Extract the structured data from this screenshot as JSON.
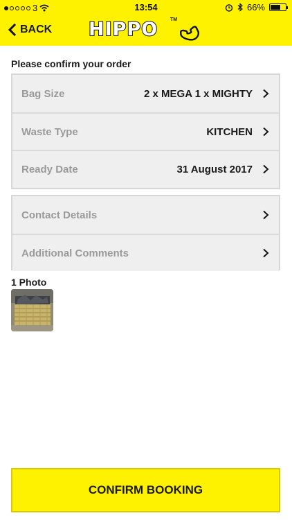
{
  "status_bar": {
    "carrier": "3",
    "time": "13:54",
    "battery_percent": "66%",
    "battery_level": 0.66
  },
  "header": {
    "back_label": "BACK",
    "logo_text": "HIPPO",
    "logo_tm": "TM",
    "brand_color": "#fff200"
  },
  "order": {
    "title": "Please confirm your order",
    "details": [
      {
        "label": "Bag Size",
        "value": "2 x MEGA 1 x MIGHTY"
      },
      {
        "label": "Waste Type",
        "value": "KITCHEN"
      },
      {
        "label": "Ready Date",
        "value": "31 August 2017"
      }
    ],
    "extra": [
      {
        "label": "Contact Details"
      },
      {
        "label": "Additional Comments"
      }
    ]
  },
  "photos": {
    "count_label": "1 Photo"
  },
  "confirm_button": {
    "label": "CONFIRM BOOKING"
  }
}
